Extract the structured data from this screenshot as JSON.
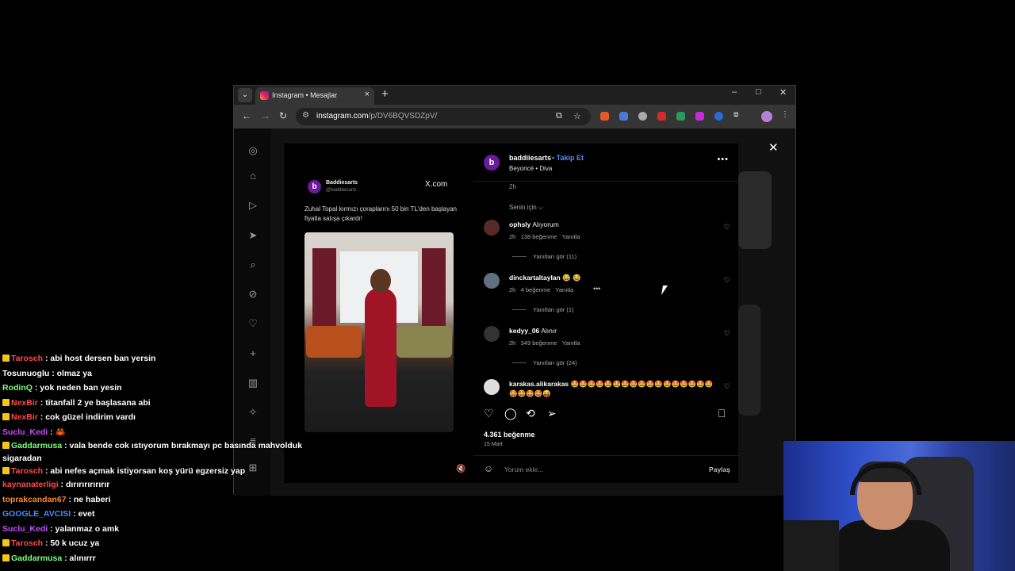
{
  "browser": {
    "tab_title": "Instagram • Mesajlar",
    "url_host": "instagram.com",
    "url_path": "/p/DV6BQVSDZpV/",
    "new_tab": "+",
    "tab_close": "×",
    "minimize": "–",
    "maximize": "□",
    "close": "✕",
    "back": "←",
    "forward": "→",
    "reload": "↻",
    "tune": "⚙",
    "cast": "⧉",
    "bookmark": "☆",
    "extensions": "⧈",
    "menu": "⋮"
  },
  "tweet": {
    "avatar_letter": "b",
    "name": "Baddiesarts",
    "handle": "@baddiiesarts",
    "source": "X.com",
    "text": "Zuhal Topal kırmızı çoraplarını 50 bin TL'den başlayan fiyatla satışa çıkardı!"
  },
  "post": {
    "avatar_letter": "b",
    "username": "baddiiesarts",
    "follow": "• Takip Et",
    "music": "Beyoncé • Diva",
    "more": "•••",
    "time": "2h",
    "sort": "Senin için ⌵",
    "comments": [
      {
        "user": "ophsly",
        "text": "Alıyorum",
        "time": "2h",
        "likes": "138 beğenme",
        "reply": "Yanıtla",
        "see_replies": "Yanıtları gör (11)"
      },
      {
        "user": "dinckartaltaylan",
        "text": "😂 😂",
        "time": "2h",
        "likes": "4 beğenme",
        "reply": "Yanıtla",
        "see_replies": "Yanıtları gör (1)"
      },
      {
        "user": "kedyy_06",
        "text": "Alınır",
        "time": "2h",
        "likes": "349 beğenme",
        "reply": "Yanıtla",
        "see_replies": "Yanıtları gör (24)"
      },
      {
        "user": "karakas.alikarakas",
        "text": "🤩🤩🤩🤩🤩🤩🤩🤩🤩🤩🤩🤩🤩🤩🤩🤩🤩🤩🤩🤩🤩😝"
      }
    ],
    "likes": "4.361 beğenme",
    "date": "15 Mart",
    "comment_placeholder": "Yorum ekle...",
    "share": "Paylaş",
    "heart": "♡",
    "dots": "•••"
  },
  "sidebar_icons": [
    "instagram-icon",
    "home-icon",
    "reels-icon",
    "messages-icon",
    "search-icon",
    "explore-icon",
    "notifications-icon",
    "create-icon",
    "dashboard-icon",
    "ai-icon",
    "menu-icon",
    "more-icon"
  ],
  "chat": [
    {
      "user": "Tarosch",
      "color": "#ff4a4a",
      "msg": ": abi host dersen ban yersin"
    },
    {
      "user": "Tosunuoglu",
      "color": "#ffffff",
      "msg": ": olmaz ya"
    },
    {
      "user": "RodinQ",
      "color": "#7cff7c",
      "msg": ": yok neden ban yesin"
    },
    {
      "user": "NexBir",
      "color": "#ff4a4a",
      "msg": ": titanfall 2 ye başlasana abi"
    },
    {
      "user": "NexBir",
      "color": "#ff4a4a",
      "msg": ": cok güzel indirim vardı"
    },
    {
      "user": "Suclu_Kedi",
      "color": "#c84bff",
      "msg": ": 🦀"
    },
    {
      "user": "Gaddarmusa",
      "color": "#7cff7c",
      "msg": ": vala bende cok ıstıyorum bırakmayı pc basında mahvolduk sigaradan"
    },
    {
      "user": "Tarosch",
      "color": "#ff4a4a",
      "msg": ": abi nefes açmak istiyorsan koş yürü egzersiz yap"
    },
    {
      "user": "kaynanaterligi",
      "color": "#ff4a4a",
      "msg": ": dırırırırırırır"
    },
    {
      "user": "toprakcandan67",
      "color": "#ff8a2a",
      "msg": ": ne haberi"
    },
    {
      "user": "GOOGLE_AVCISI",
      "color": "#4a8aff",
      "msg": ": evet"
    },
    {
      "user": "Suclu_Kedi",
      "color": "#c84bff",
      "msg": ": yalanmaz o amk"
    },
    {
      "user": "Tarosch",
      "color": "#ff4a4a",
      "msg": ": 50 k ucuz ya"
    },
    {
      "user": "Gaddarmusa",
      "color": "#7cff7c",
      "msg": ": alınırrr"
    }
  ],
  "colors": {
    "accent_follow": "#5b8cff",
    "badge_sub": "#f5c518",
    "badge_mod": "#4a90e2"
  }
}
